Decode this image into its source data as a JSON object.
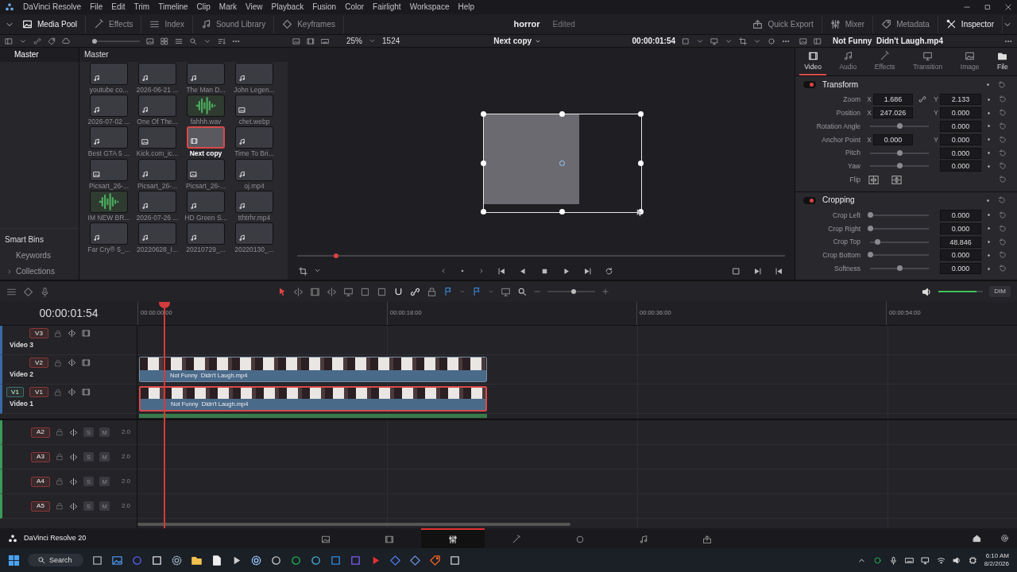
{
  "title_bar": {
    "app_name": "DaVinci Resolve",
    "menu": [
      "File",
      "Edit",
      "Trim",
      "Timeline",
      "Clip",
      "Mark",
      "View",
      "Playback",
      "Fusion",
      "Color",
      "Fairlight",
      "Workspace",
      "Help"
    ]
  },
  "toolbar": {
    "left": [
      {
        "label": "Media Pool",
        "selected": true
      },
      {
        "label": "Effects",
        "selected": false
      },
      {
        "label": "Index",
        "selected": false
      },
      {
        "label": "Sound Library",
        "selected": false
      },
      {
        "label": "Keyframes",
        "selected": false
      }
    ],
    "project": "horror",
    "project_status": "Edited",
    "right": [
      {
        "label": "Quick Export",
        "selected": false
      },
      {
        "label": "Mixer",
        "selected": false
      },
      {
        "label": "Metadata",
        "selected": false
      },
      {
        "label": "Inspector",
        "selected": true
      }
    ]
  },
  "viewer_bar": {
    "zoom": "25%",
    "frame": "1524",
    "timeline_name": "Next copy",
    "timecode": "00:00:01:54",
    "clip_name": "Not Funny  Didn't Laugh.mp4"
  },
  "bins": {
    "root": {
      "label": "Master",
      "selected": true
    },
    "smart_bins_title": "Smart Bins",
    "smart_bins": [
      {
        "label": "Keywords",
        "expandable": false
      },
      {
        "label": "Collections",
        "expandable": true
      }
    ]
  },
  "media_pool": {
    "path": "Master",
    "thumb_size": {
      "level": 0
    },
    "clips": [
      {
        "name": "youtube co...",
        "kind": "video",
        "selected": false
      },
      {
        "name": "2026-06-21 ...",
        "kind": "video",
        "selected": false
      },
      {
        "name": "The Man D...",
        "kind": "video",
        "selected": false
      },
      {
        "name": "John Legen...",
        "kind": "video",
        "selected": false
      },
      {
        "name": "2026-07-02 ...",
        "kind": "video",
        "selected": false
      },
      {
        "name": "One Of The...",
        "kind": "video",
        "selected": false
      },
      {
        "name": "fahhh.wav",
        "kind": "audio",
        "selected": false
      },
      {
        "name": "chet.webp",
        "kind": "image",
        "selected": false
      },
      {
        "name": "Best GTA 5 ...",
        "kind": "video",
        "selected": false
      },
      {
        "name": "Kick.com_ic...",
        "kind": "image",
        "selected": false
      },
      {
        "name": "Next copy",
        "kind": "timeline",
        "selected": true
      },
      {
        "name": "Time To Bri...",
        "kind": "video",
        "selected": false
      },
      {
        "name": "Picsart_26-...",
        "kind": "image",
        "selected": false
      },
      {
        "name": "Picsart_26-...",
        "kind": "video",
        "selected": false
      },
      {
        "name": "Picsart_26-...",
        "kind": "image",
        "selected": false
      },
      {
        "name": "oj.mp4",
        "kind": "video",
        "selected": false
      },
      {
        "name": "IM NEW BR...",
        "kind": "audio",
        "selected": false
      },
      {
        "name": "2026-07-26 ...",
        "kind": "video",
        "selected": false
      },
      {
        "name": "HD Green S...",
        "kind": "video",
        "selected": false
      },
      {
        "name": "tthtrhr.mp4",
        "kind": "video",
        "selected": false
      },
      {
        "name": "Far Cry® 5_...",
        "kind": "video",
        "selected": false
      },
      {
        "name": "20220628_I...",
        "kind": "video",
        "selected": false
      },
      {
        "name": "20210729_...",
        "kind": "video",
        "selected": false
      },
      {
        "name": "20220130_...",
        "kind": "video",
        "selected": false
      }
    ]
  },
  "viewer": {
    "scrubber": {
      "level": 0.08
    }
  },
  "inspector": {
    "tabs": [
      {
        "label": "Video",
        "selected": true,
        "disabled": false
      },
      {
        "label": "Audio",
        "selected": false,
        "disabled": true
      },
      {
        "label": "Effects",
        "selected": false,
        "disabled": true
      },
      {
        "label": "Transition",
        "selected": false,
        "disabled": true
      },
      {
        "label": "Image",
        "selected": false,
        "disabled": true
      },
      {
        "label": "File",
        "selected": false,
        "disabled": false
      }
    ],
    "sections": [
      {
        "title": "Transform",
        "enabled": true,
        "rows": [
          {
            "label": "Zoom",
            "kind": "xy",
            "x": {
              "axis": "X",
              "value": "1.686"
            },
            "y": {
              "axis": "Y",
              "value": "2.133"
            },
            "linked": true
          },
          {
            "label": "Position",
            "kind": "xy",
            "x": {
              "axis": "X",
              "value": "247.026"
            },
            "y": {
              "axis": "Y",
              "value": "0.000"
            },
            "linked": false
          },
          {
            "label": "Rotation Angle",
            "kind": "slider",
            "level": 0.5,
            "value": "0.000"
          },
          {
            "label": "Anchor Point",
            "kind": "xy",
            "x": {
              "axis": "X",
              "value": "0.000"
            },
            "y": {
              "axis": "Y",
              "value": "0.000"
            },
            "linked": false
          },
          {
            "label": "Pitch",
            "kind": "slider",
            "level": 0.5,
            "value": "0.000"
          },
          {
            "label": "Yaw",
            "kind": "slider",
            "level": 0.5,
            "value": "0.000"
          },
          {
            "label": "Flip",
            "kind": "flip"
          }
        ]
      },
      {
        "title": "Cropping",
        "enabled": true,
        "rows": [
          {
            "label": "Crop Left",
            "kind": "slider",
            "level": 0,
            "value": "0.000"
          },
          {
            "label": "Crop Right",
            "kind": "slider",
            "level": 0,
            "value": "0.000"
          },
          {
            "label": "Crop Top",
            "kind": "slider",
            "level": 0.12,
            "value": "48.846"
          },
          {
            "label": "Crop Bottom",
            "kind": "slider",
            "level": 0,
            "value": "0.000"
          },
          {
            "label": "Softness",
            "kind": "slider",
            "level": 0.5,
            "value": "0.000"
          }
        ]
      }
    ]
  },
  "timeline": {
    "timecode": "00:00:01:54",
    "ruler": [
      "00:00:00:00",
      "00:00:18:00",
      "00:00:36:00",
      "00:00:54:00"
    ],
    "volume": {
      "level": 0.85
    },
    "dim": "DIM",
    "zoom": {
      "level": 0.55
    },
    "video_tracks": [
      {
        "id": "V3",
        "name": "Video 3"
      },
      {
        "id": "V2",
        "name": "Video 2",
        "clip": {
          "name": "Not Funny  Didn't Laugh.mp4",
          "selected": false
        }
      },
      {
        "id": "V1",
        "name": "Video 1",
        "patch": "V1",
        "clip": {
          "name": "Not Funny  Didn't Laugh.mp4",
          "selected": true
        }
      }
    ],
    "audio_tracks": [
      {
        "id": "A2",
        "solo": "S",
        "mute": "M",
        "channels": "2.0"
      },
      {
        "id": "A3",
        "solo": "S",
        "mute": "M",
        "channels": "2.0"
      },
      {
        "id": "A4",
        "solo": "S",
        "mute": "M",
        "channels": "2.0"
      },
      {
        "id": "A5",
        "solo": "S",
        "mute": "M",
        "channels": "2.0"
      }
    ]
  },
  "page_bar": {
    "app_version": "DaVinci Resolve 20",
    "pages": [
      {
        "selected": false
      },
      {
        "selected": false
      },
      {
        "selected": true
      },
      {
        "selected": false
      },
      {
        "selected": false
      },
      {
        "selected": false
      },
      {
        "selected": false
      }
    ]
  },
  "taskbar": {
    "search": "Search",
    "time": "6:10 AM",
    "date": "8/2/2026"
  }
}
